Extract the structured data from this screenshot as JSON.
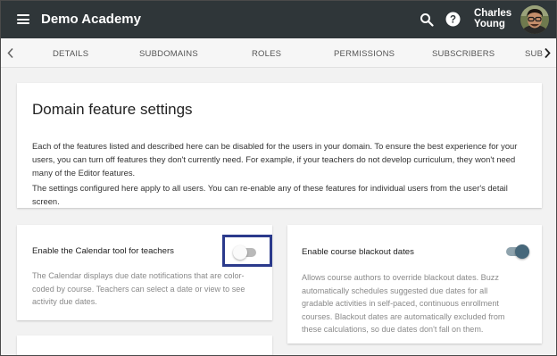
{
  "app": {
    "title": "Demo Academy",
    "user_first": "Charles",
    "user_last": "Young"
  },
  "icons": {
    "menu": "hamburger-menu-icon",
    "search": "search-icon",
    "help": "help-icon",
    "prev": "chevron-left-icon",
    "next": "chevron-right-icon"
  },
  "tabs": [
    {
      "label": "DETAILS"
    },
    {
      "label": "SUBDOMAINS"
    },
    {
      "label": "ROLES"
    },
    {
      "label": "PERMISSIONS"
    },
    {
      "label": "SUBSCRIBERS"
    },
    {
      "label": "SUB"
    }
  ],
  "settings": {
    "title": "Domain feature settings",
    "para1_line1": "Each of the features listed and described here can be disabled for the users in your domain. To ensure the best experience for your",
    "para1_line2": "users, you can turn off features they don't currently need. For example, if your teachers do not develop curriculum, they won't need",
    "para1_line3": "many of the Editor features.",
    "para2_line1": "The settings configured here apply to all users. You can re-enable any of these features for individual users from the user's detail",
    "para2_line2": "screen."
  },
  "features": [
    {
      "title": "Enable the Calendar tool for teachers",
      "enabled": false,
      "desc_lines": [
        "The Calendar displays due date notifications that are color-",
        "coded by course. Teachers can select a date or view to see",
        "activity due dates."
      ]
    },
    {
      "title": "Enable course blackout dates",
      "enabled": true,
      "desc_lines": [
        "Allows course authors to override blackout dates. Buzz",
        "automatically schedules suggested due dates for all",
        "gradable activities in self-paced, continuous enrollment",
        "courses. Blackout dates are automatically excluded from",
        "these calculations, so due dates don't fall on them."
      ]
    }
  ],
  "colors": {
    "appbar": "#2f3639",
    "toggle_on_track": "#8fa3ad",
    "toggle_on_knob": "#46677a",
    "toggle_off_track": "#b9b9b9",
    "toggle_off_knob": "#fafafa",
    "highlight": "#2b3a8c"
  }
}
